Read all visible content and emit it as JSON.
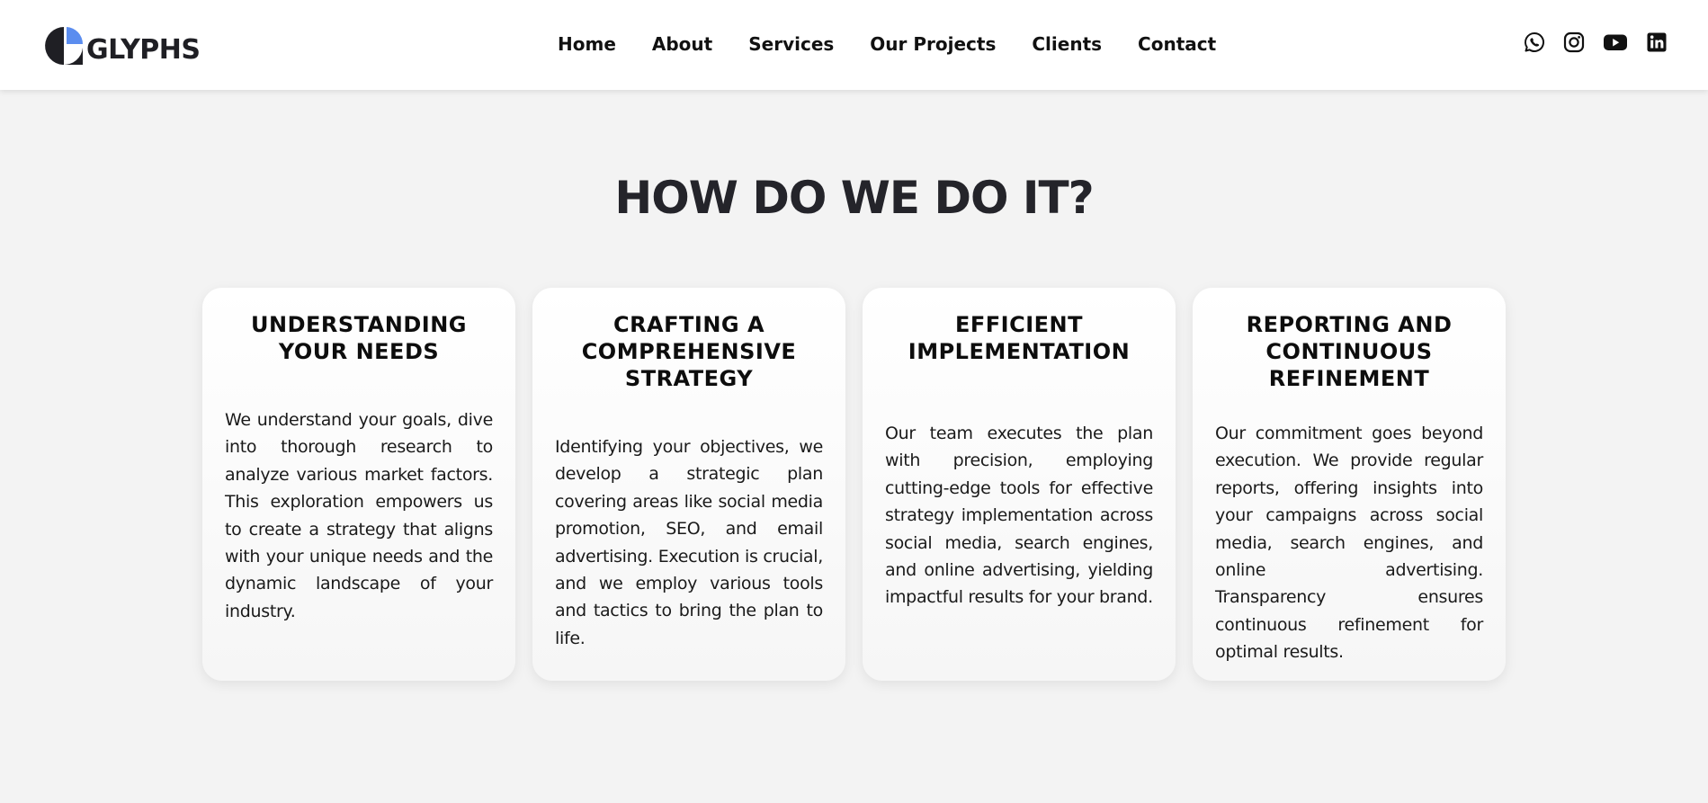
{
  "brand": {
    "name": "GLYPHS",
    "logo_icon": "glyphs-logo-icon",
    "accent": "#5b8def",
    "dark": "#1f1f24"
  },
  "nav": {
    "items": [
      {
        "label": "Home"
      },
      {
        "label": "About"
      },
      {
        "label": "Services"
      },
      {
        "label": "Our Projects"
      },
      {
        "label": "Clients"
      },
      {
        "label": "Contact"
      }
    ]
  },
  "social": [
    "whatsapp-icon",
    "instagram-icon",
    "youtube-icon",
    "linkedin-icon"
  ],
  "section": {
    "title": "HOW DO WE DO IT?",
    "cards": [
      {
        "title": "UNDERSTANDING YOUR NEEDS",
        "text": "We understand your goals, dive into thorough research to analyze various market factors. This exploration empowers us to create a strategy that aligns with your unique needs and the dynamic landscape of your industry."
      },
      {
        "title": "CRAFTING A COMPREHENSIVE STRATEGY",
        "text": "Identifying your objectives, we develop a strategic plan covering areas like social media promotion, SEO, and email advertising. Execution is crucial, and we employ various tools and tactics to bring the plan to life."
      },
      {
        "title": "EFFICIENT IMPLEMENTATION",
        "text": "Our team executes the plan with precision, employing cutting-edge tools for effective strategy implementation across social media, search engines, and online advertising, yielding impactful results for your brand."
      },
      {
        "title": "REPORTING AND CONTINUOUS REFINEMENT",
        "text": "Our commitment goes beyond execution. We provide regular reports, offering insights into your campaigns across social media, search engines, and online advertising. Transparency ensures continuous refinement for optimal results."
      }
    ]
  }
}
